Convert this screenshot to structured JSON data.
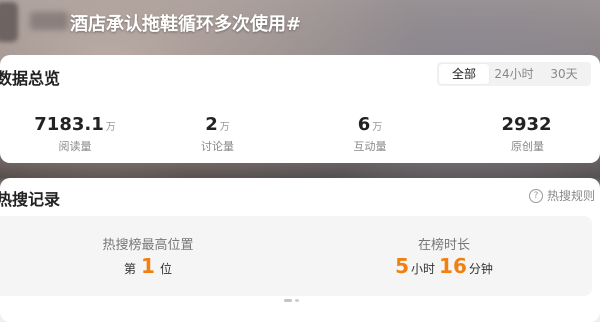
{
  "topic": {
    "title": "酒店承认拖鞋循环多次使用#"
  },
  "overview": {
    "title": "数据总览",
    "range_tabs": [
      {
        "label": "全部",
        "active": true
      },
      {
        "label": "24小时",
        "active": false
      },
      {
        "label": "30天",
        "active": false
      }
    ],
    "stats": [
      {
        "value": "7183.1",
        "unit": "万",
        "label": "阅读量"
      },
      {
        "value": "2",
        "unit": "万",
        "label": "讨论量"
      },
      {
        "value": "6",
        "unit": "万",
        "label": "互动量"
      },
      {
        "value": "2932",
        "unit": "",
        "label": "原创量"
      }
    ]
  },
  "hot_record": {
    "title": "热搜记录",
    "rules_label": "热搜规则",
    "help_icon": "?",
    "peak": {
      "label": "热搜榜最高位置",
      "prefix": "第",
      "value": "1",
      "suffix": "位"
    },
    "duration": {
      "label": "在榜时长",
      "hours": "5",
      "hours_unit": "小时",
      "minutes": "16",
      "minutes_unit": "分钟"
    }
  },
  "colors": {
    "accent_orange": "#f0800f",
    "card_bg": "#ffffff",
    "panel_bg": "#f5f5f6"
  }
}
